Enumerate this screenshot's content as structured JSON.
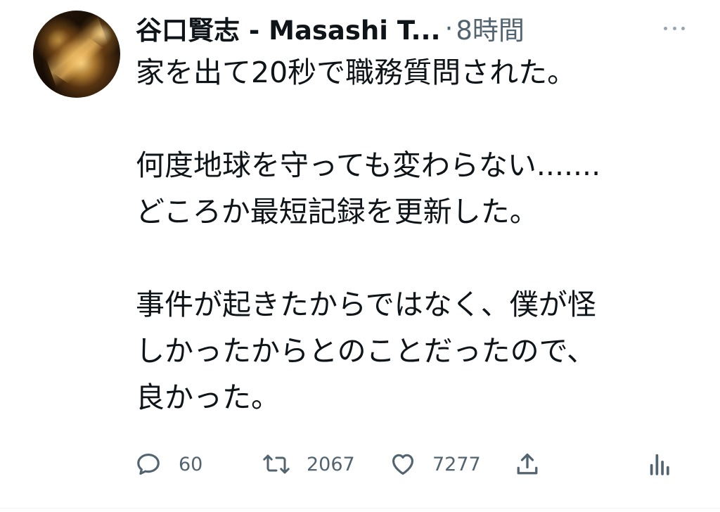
{
  "tweet": {
    "author_name": "谷口賢志 - Masashi T...",
    "separator": "·",
    "timestamp": "8時間",
    "body_lines": [
      "家を出て20秒で職務質問された。",
      "",
      "何度地球を守っても変わらない.......",
      "どころか最短記録を更新した。",
      "",
      "事件が起きたからではなく、僕が怪",
      "しかったからとのことだったので、",
      "良かった。"
    ],
    "actions": {
      "reply_count": "60",
      "retweet_count": "2067",
      "like_count": "7277"
    },
    "icons": {
      "more": "more-horizontal-icon",
      "reply": "reply-bubble-icon",
      "retweet": "retweet-icon",
      "like": "heart-icon",
      "share": "share-upload-icon",
      "analytics": "analytics-bars-icon"
    },
    "colors": {
      "text": "#0f1419",
      "secondary": "#536471",
      "background": "#ffffff"
    }
  }
}
